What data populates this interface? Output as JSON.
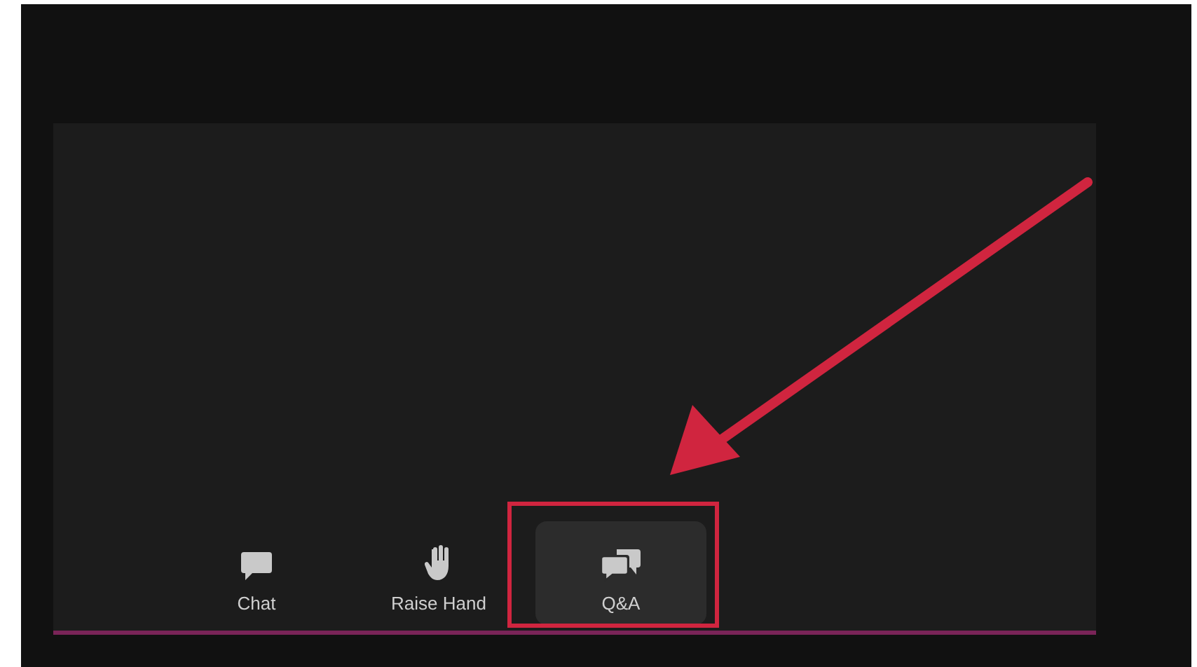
{
  "toolbar": {
    "items": [
      {
        "label": "Chat",
        "kind": "chat",
        "selected": false
      },
      {
        "label": "Raise Hand",
        "kind": "hand",
        "selected": false
      },
      {
        "label": "Q&A",
        "kind": "qa",
        "selected": true
      }
    ]
  }
}
